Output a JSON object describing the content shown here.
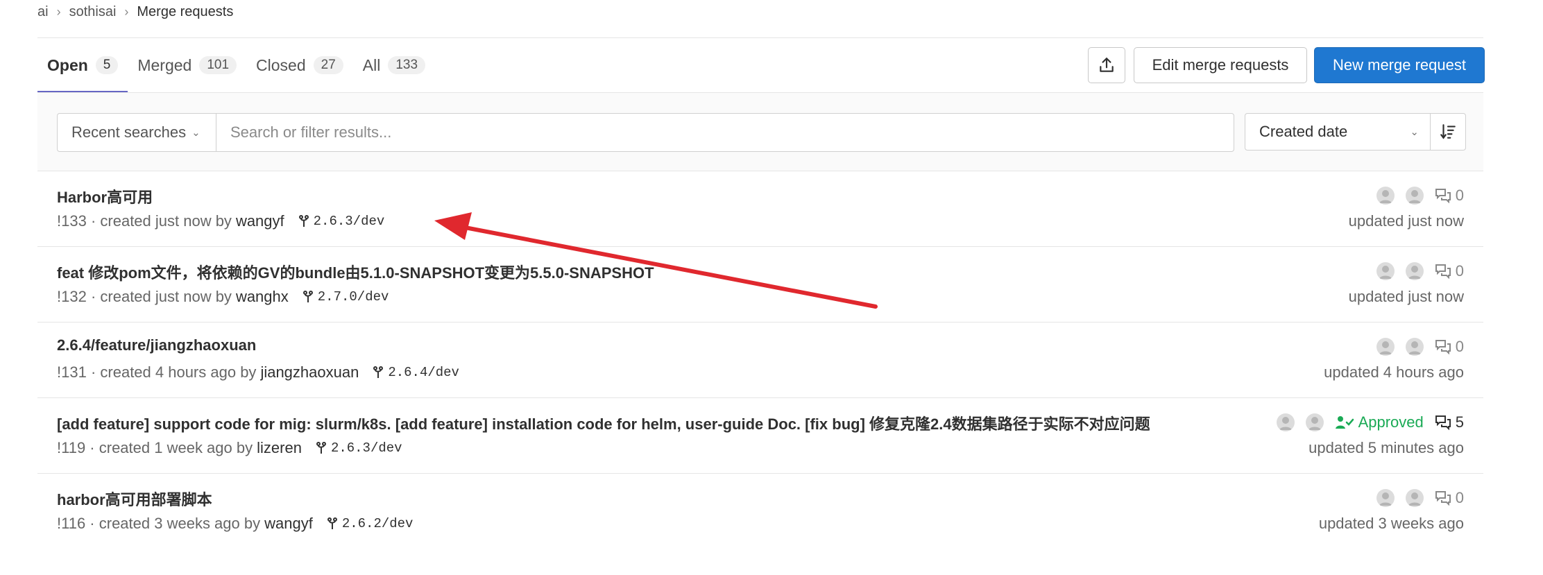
{
  "breadcrumb": {
    "items": [
      "ai",
      "sothisai",
      "Merge requests"
    ]
  },
  "tabs": [
    {
      "label": "Open",
      "count": "5",
      "active": true
    },
    {
      "label": "Merged",
      "count": "101",
      "active": false
    },
    {
      "label": "Closed",
      "count": "27",
      "active": false
    },
    {
      "label": "All",
      "count": "133",
      "active": false
    }
  ],
  "actions": {
    "export_icon": "export-icon",
    "edit_label": "Edit merge requests",
    "new_label": "New merge request"
  },
  "filter": {
    "recent_label": "Recent searches",
    "search_placeholder": "Search or filter results...",
    "sort_label": "Created date",
    "sort_direction_icon": "sort-descending-icon"
  },
  "merge_requests": [
    {
      "title": "Harbor高可用",
      "ref": "!133",
      "created": "created just now by",
      "author": "wangyf",
      "branch": "2.6.3/dev",
      "approved": "",
      "comments": "0",
      "updated": "updated just now"
    },
    {
      "title": "feat 修改pom文件，将依赖的GV的bundle由5.1.0-SNAPSHOT变更为5.5.0-SNAPSHOT",
      "ref": "!132",
      "created": "created just now by",
      "author": "wanghx",
      "branch": "2.7.0/dev",
      "approved": "",
      "comments": "0",
      "updated": "updated just now"
    },
    {
      "title": "2.6.4/feature/jiangzhaoxuan",
      "ref": "!131",
      "created": "created 4 hours ago by",
      "author": "jiangzhaoxuan",
      "branch": "2.6.4/dev",
      "approved": "",
      "comments": "0",
      "updated": "updated 4 hours ago"
    },
    {
      "title": "[add feature] support code for mig: slurm/k8s. [add feature] installation code for helm, user-guide Doc. [fix bug] 修复克隆2.4数据集路径于实际不对应问题",
      "ref": "!119",
      "created": "created 1 week ago by",
      "author": "lizeren",
      "branch": "2.6.3/dev",
      "approved": "Approved",
      "comments": "5",
      "updated": "updated 5 minutes ago"
    },
    {
      "title": "harbor高可用部署脚本",
      "ref": "!116",
      "created": "created 3 weeks ago by",
      "author": "wangyf",
      "branch": "2.6.2/dev",
      "approved": "",
      "comments": "0",
      "updated": "updated 3 weeks ago"
    }
  ],
  "colors": {
    "primary": "#1f78d1",
    "active_tab": "#6666c4",
    "approved": "#1aaa55",
    "annotation_arrow": "#e0282e"
  }
}
